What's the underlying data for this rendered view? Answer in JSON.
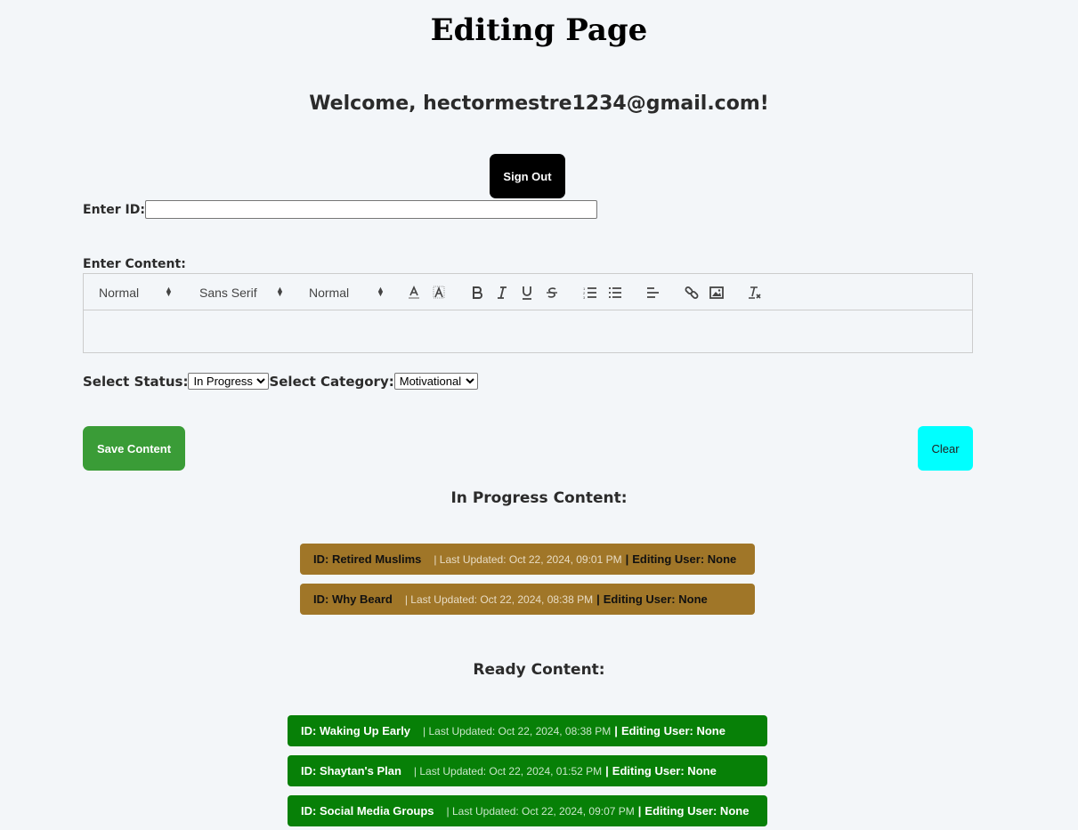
{
  "header": {
    "title": "Editing Page",
    "welcome": "Welcome, hectormestre1234@gmail.com!",
    "sign_out_label": "Sign Out"
  },
  "form": {
    "id_label": "Enter ID:",
    "id_value": "",
    "content_label": "Enter Content:",
    "toolbar": {
      "header_picker": "Normal",
      "font_picker": "Sans Serif",
      "size_picker": "Normal",
      "icons": [
        "text-color",
        "background-color",
        "bold",
        "italic",
        "underline",
        "strike",
        "ordered-list",
        "bullet-list",
        "align",
        "link",
        "image",
        "clean"
      ]
    },
    "content_value": "",
    "status_label": "Select Status:",
    "status_selected": "In Progress",
    "category_label": "Select Category:",
    "category_selected": "Motivational",
    "save_label": "Save Content",
    "clear_label": "Clear"
  },
  "in_progress": {
    "title": "In Progress Content:",
    "color": "#a07628",
    "items": [
      {
        "id": "ID: Retired Muslims",
        "updated": "| Last Updated: Oct 22, 2024, 09:01 PM",
        "sep": "|",
        "editing": "Editing User: None"
      },
      {
        "id": "ID: Why Beard",
        "updated": "| Last Updated: Oct 22, 2024, 08:38 PM",
        "sep": "|",
        "editing": "Editing User: None"
      }
    ]
  },
  "ready": {
    "title": "Ready Content:",
    "color": "#078007",
    "items": [
      {
        "id": "ID: Waking Up Early",
        "updated": "| Last Updated: Oct 22, 2024, 08:38 PM",
        "sep": "|",
        "editing": "Editing User: None"
      },
      {
        "id": "ID: Shaytan's Plan",
        "updated": "| Last Updated: Oct 22, 2024, 01:52 PM",
        "sep": "|",
        "editing": "Editing User: None"
      },
      {
        "id": "ID: Social Media Groups",
        "updated": "| Last Updated: Oct 22, 2024, 09:07 PM",
        "sep": "|",
        "editing": "Editing User: None"
      }
    ]
  }
}
